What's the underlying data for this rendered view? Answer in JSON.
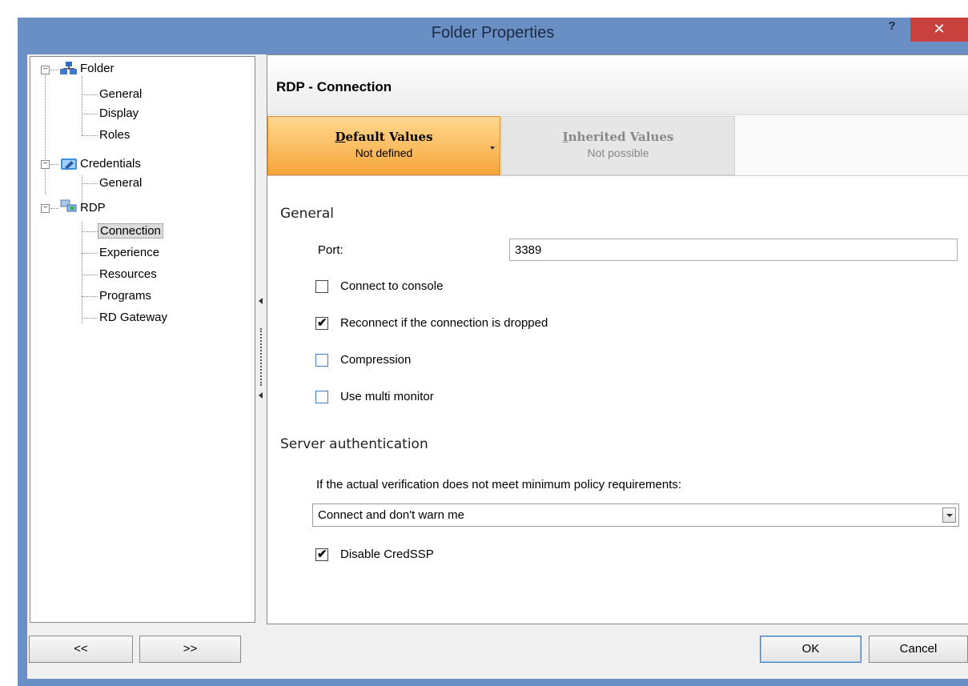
{
  "window": {
    "title": "Folder Properties",
    "help_label": "?",
    "close_label": "✕"
  },
  "tree": {
    "folder": {
      "label": "Folder",
      "children": [
        "General",
        "Display",
        "Roles"
      ]
    },
    "credentials": {
      "label": "Credentials",
      "children": [
        "General"
      ]
    },
    "rdp": {
      "label": "RDP",
      "children": [
        "Connection",
        "Experience",
        "Resources",
        "Programs",
        "RD Gateway"
      ]
    },
    "expander_symbol": "−",
    "selected": "Connection"
  },
  "panel": {
    "title": "RDP - Connection",
    "tabs": {
      "default": {
        "title_first": "D",
        "title_rest": "efault Values",
        "subtitle": "Not defined"
      },
      "inherited": {
        "title_first": "I",
        "title_rest": "nherited Values",
        "subtitle": "Not possible"
      }
    },
    "general": {
      "heading": "General",
      "port_label": "Port:",
      "port_value": "3389",
      "connect_console": {
        "label": "Connect to console",
        "checked": false
      },
      "reconnect": {
        "label": "Reconnect if the connection is dropped",
        "checked": true
      },
      "compression": {
        "label": "Compression",
        "checked": false
      },
      "multi_monitor": {
        "label": "Use multi monitor",
        "checked": false
      }
    },
    "server_auth": {
      "heading": "Server authentication",
      "description": "If the actual verification does not meet minimum policy requirements:",
      "selected_option": "Connect and don't warn me",
      "disable_credssp": {
        "label": "Disable CredSSP",
        "checked": true
      }
    }
  },
  "footer": {
    "prev_label": "<<",
    "next_label": ">>",
    "ok_label": "OK",
    "cancel_label": "Cancel"
  },
  "check_mark": "✔",
  "colors": {
    "title_bar": "#6a8fc4",
    "close_button": "#c8413c",
    "active_tab": "#f7a53a",
    "checkbox_blue": "#3d7fc4"
  }
}
